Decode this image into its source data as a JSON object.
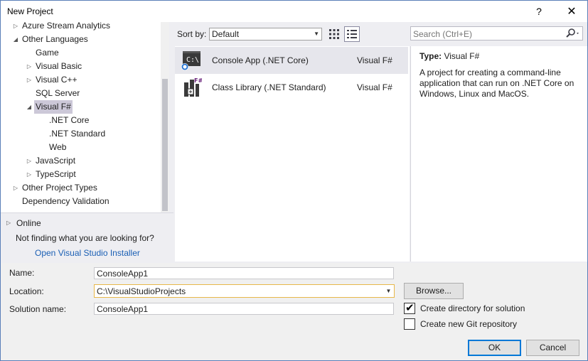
{
  "window": {
    "title": "New Project",
    "help_glyph": "?",
    "close_glyph": "✕"
  },
  "tree": {
    "items": [
      {
        "label": "Azure Stream Analytics",
        "expander": "▷"
      },
      {
        "label": "Other Languages",
        "expander": "◢"
      },
      {
        "label": "Game",
        "expander": ""
      },
      {
        "label": "Visual Basic",
        "expander": "▷"
      },
      {
        "label": "Visual C++",
        "expander": "▷"
      },
      {
        "label": "SQL Server",
        "expander": ""
      },
      {
        "label": "Visual F#",
        "expander": "◢",
        "selected": true
      },
      {
        "label": ".NET Core",
        "expander": ""
      },
      {
        "label": ".NET Standard",
        "expander": ""
      },
      {
        "label": "Web",
        "expander": ""
      },
      {
        "label": "JavaScript",
        "expander": "▷"
      },
      {
        "label": "TypeScript",
        "expander": "▷"
      },
      {
        "label": "Other Project Types",
        "expander": "▷"
      },
      {
        "label": "Dependency Validation",
        "expander": ""
      }
    ]
  },
  "online": {
    "label": "Online",
    "expander": "▷"
  },
  "not_finding": "Not finding what you are looking for?",
  "installer_link": "Open Visual Studio Installer",
  "sort": {
    "label": "Sort by:",
    "value": "Default",
    "arrow": "▼"
  },
  "search": {
    "placeholder": "Search (Ctrl+E)"
  },
  "templates": [
    {
      "name": "Console App (.NET Core)",
      "language": "Visual F#",
      "icon": "console-app-icon",
      "selected": true
    },
    {
      "name": "Class Library (.NET Standard)",
      "language": "Visual F#",
      "icon": "class-library-icon",
      "selected": false
    }
  ],
  "description": {
    "type_key": "Type:",
    "type_value": "Visual F#",
    "text": "A project for creating a command-line application that can run on .NET Core on Windows, Linux and MacOS."
  },
  "form": {
    "name_label": "Name:",
    "name_value": "ConsoleApp1",
    "location_label": "Location:",
    "location_value": "C:\\VisualStudioProjects",
    "location_arrow": "▼",
    "solution_label": "Solution name:",
    "solution_value": "ConsoleApp1",
    "browse_label": "Browse...",
    "create_dir_label": "Create directory for solution",
    "create_dir_checked": true,
    "check_glyph": "✔",
    "git_label": "Create new Git repository",
    "git_checked": false,
    "ok_label": "OK",
    "cancel_label": "Cancel"
  },
  "colors": {
    "accent_blue": "#0078d7",
    "link_blue": "#1a5fb4",
    "selection": "#ccc8d8",
    "fsharp_purple": "#68217a"
  }
}
